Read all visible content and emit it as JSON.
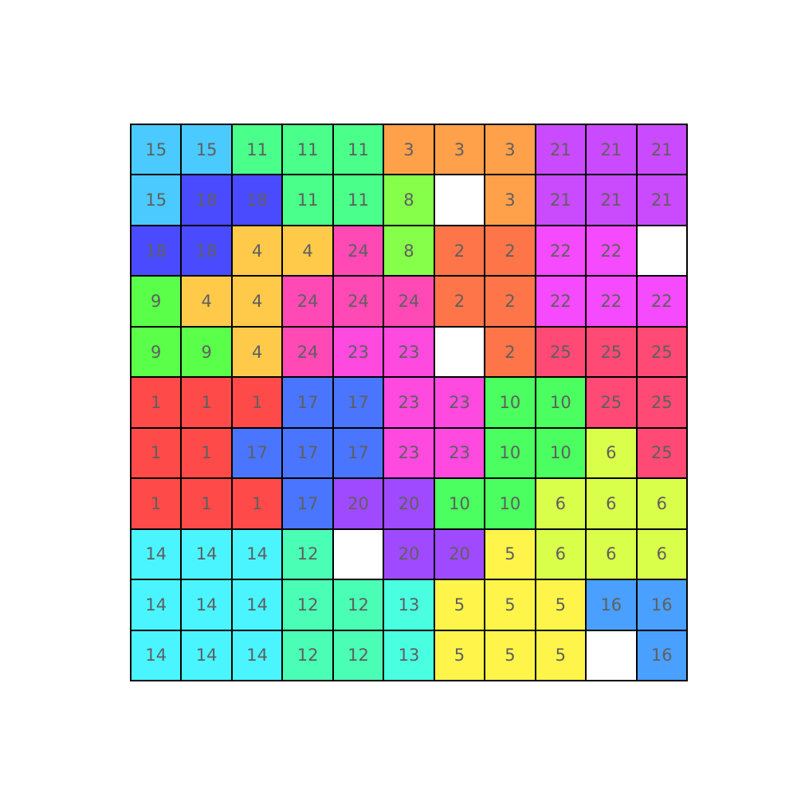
{
  "board": {
    "rows": 11,
    "cols": 11,
    "cells": [
      [
        15,
        15,
        11,
        11,
        11,
        3,
        3,
        3,
        21,
        21,
        21
      ],
      [
        15,
        18,
        18,
        11,
        11,
        8,
        null,
        3,
        21,
        21,
        21
      ],
      [
        18,
        18,
        4,
        4,
        24,
        8,
        2,
        2,
        22,
        22,
        null
      ],
      [
        9,
        4,
        4,
        24,
        24,
        24,
        2,
        2,
        22,
        22,
        22
      ],
      [
        9,
        9,
        4,
        24,
        23,
        23,
        null,
        2,
        25,
        25,
        25
      ],
      [
        1,
        1,
        1,
        17,
        17,
        23,
        23,
        10,
        10,
        25,
        25
      ],
      [
        1,
        1,
        17,
        17,
        17,
        23,
        23,
        10,
        10,
        6,
        25
      ],
      [
        1,
        1,
        1,
        17,
        20,
        20,
        10,
        10,
        6,
        6,
        6
      ],
      [
        14,
        14,
        14,
        12,
        null,
        20,
        20,
        5,
        6,
        6,
        6
      ],
      [
        14,
        14,
        14,
        12,
        12,
        13,
        5,
        5,
        5,
        16,
        16
      ],
      [
        14,
        14,
        14,
        12,
        12,
        13,
        5,
        5,
        5,
        null,
        16
      ]
    ],
    "empty_color": "#ffffff",
    "text_color": "#5f5f5f",
    "grid_color": "#000000"
  },
  "region_colors": {
    "1": "#ff4a4a",
    "2": "#ff754a",
    "3": "#ffa04a",
    "4": "#ffca4a",
    "5": "#fff54a",
    "6": "#daff4a",
    "8": "#85ff4a",
    "9": "#5aff4a",
    "10": "#4aff5f",
    "11": "#4aff8a",
    "12": "#4affb5",
    "13": "#4affe0",
    "14": "#4af5ff",
    "15": "#4acaff",
    "16": "#4aa0ff",
    "17": "#4a75ff",
    "18": "#4a4aff",
    "20": "#a04aff",
    "21": "#ca4aff",
    "22": "#f54aff",
    "23": "#ff4ae0",
    "24": "#ff4ab5",
    "25": "#ff4a75"
  }
}
